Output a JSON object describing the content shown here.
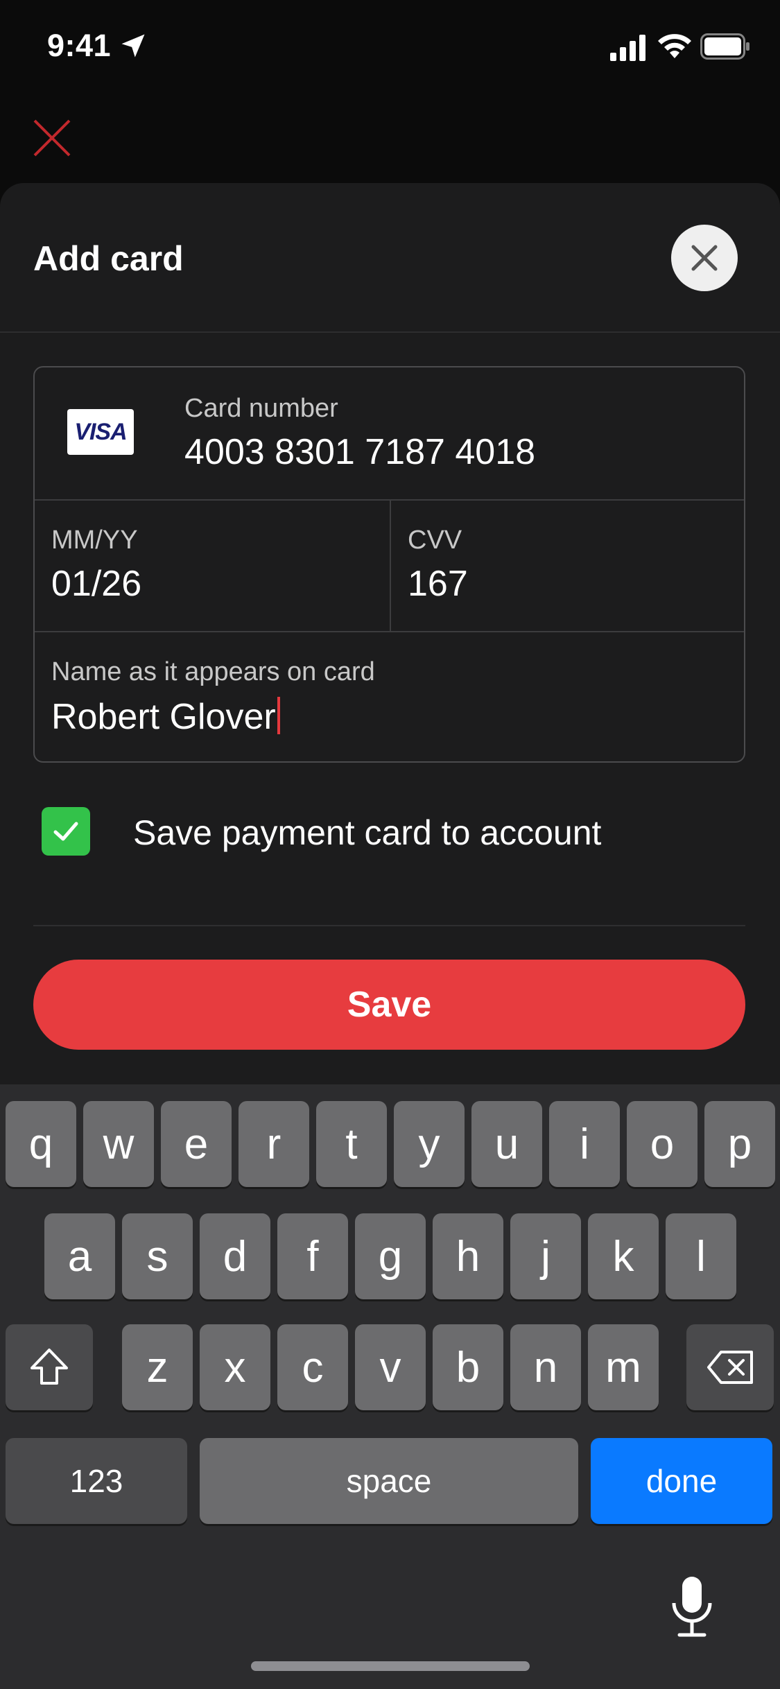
{
  "status_bar": {
    "time": "9:41"
  },
  "sheet": {
    "title": "Add card",
    "card_number_label": "Card number",
    "card_number_value": "4003 8301 7187 4018",
    "card_brand": "VISA",
    "expiry_label": "MM/YY",
    "expiry_value": "01/26",
    "cvv_label": "CVV",
    "cvv_value": "167",
    "name_label": "Name as it appears on card",
    "name_value": "Robert Glover",
    "save_card_label": "Save payment card to account",
    "save_card_checked": true,
    "save_button": "Save"
  },
  "keyboard": {
    "row1": [
      "q",
      "w",
      "e",
      "r",
      "t",
      "y",
      "u",
      "i",
      "o",
      "p"
    ],
    "row2": [
      "a",
      "s",
      "d",
      "f",
      "g",
      "h",
      "j",
      "k",
      "l"
    ],
    "row3": [
      "z",
      "x",
      "c",
      "v",
      "b",
      "n",
      "m"
    ],
    "numbers_key": "123",
    "space_key": "space",
    "done_key": "done"
  },
  "colors": {
    "accent_red": "#e73c3f",
    "checkbox_green": "#33c24a",
    "keyboard_blue": "#0a7aff"
  }
}
